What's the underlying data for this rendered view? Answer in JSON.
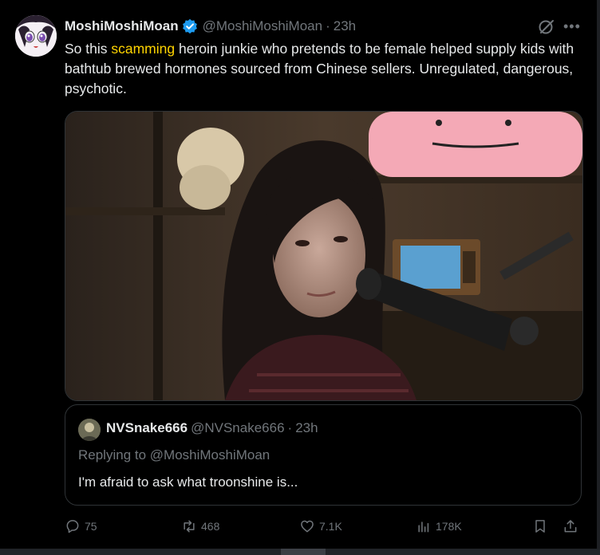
{
  "post": {
    "author_name": "MoshiMoshiMoan",
    "author_handle": "@MoshiMoshiMoan",
    "separator": "·",
    "time": "23h",
    "text_before": "So this ",
    "text_highlight": "scamming",
    "text_after": " heroin junkie who pretends to be female helped supply kids with bathtub brewed hormones sourced from Chinese sellers. Unregulated, dangerous, psychotic.",
    "more_label": "•••"
  },
  "quote": {
    "author_name": "NVSnake666",
    "author_handle": "@NVSnake666",
    "separator": "·",
    "time": "23h",
    "replying_to": "Replying to @MoshiMoshiMoan",
    "text": "I'm afraid to ask what troonshine is..."
  },
  "actions": {
    "replies": "75",
    "reposts": "468",
    "likes": "7.1K",
    "views": "178K"
  },
  "colors": {
    "background": "#000000",
    "text": "#e7e9ea",
    "muted": "#71767b",
    "highlight": "#ffd400",
    "verified": "#1d9bf0",
    "border": "#2f3336"
  }
}
